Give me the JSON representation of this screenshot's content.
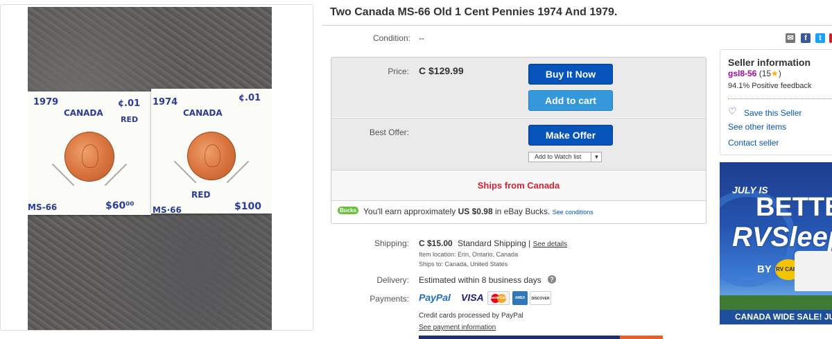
{
  "listing": {
    "title": "Two Canada MS-66 Old 1 Cent Pennies 1974 And 1979.",
    "condition_label": "Condition:",
    "condition_value": "--",
    "price_label": "Price:",
    "price_value": "C $129.99",
    "buy_now_label": "Buy It Now",
    "add_to_cart_label": "Add to cart",
    "best_offer_label": "Best Offer:",
    "make_offer_label": "Make Offer",
    "watch_label": "Add to Watch list",
    "ships_from": "Ships from Canada",
    "bucks_badge": "Bucks",
    "bucks_text": "You'll earn approximately",
    "bucks_amount": "US $0.98",
    "bucks_suffix": "in eBay Bucks.",
    "bucks_conditions": "See conditions"
  },
  "shipping": {
    "label": "Shipping:",
    "cost": "C $15.00",
    "method": "Standard Shipping",
    "details_link": "See details",
    "location": "Item location:  Erin, Ontario, Canada",
    "ships_to": "Ships to:  Canada, United States"
  },
  "delivery": {
    "label": "Delivery:",
    "value": "Estimated within 8 business days",
    "info_icon": "?"
  },
  "payments": {
    "label": "Payments:",
    "paypal": "PayPal",
    "visa": "VISA",
    "mastercard": "MasterCard",
    "amex": "AMEX",
    "discover": "DISCOVER",
    "credit_note": "Credit cards processed by PayPal",
    "info_link": "See payment information"
  },
  "seller": {
    "heading": "Seller information",
    "username": "gsl8-56",
    "feedback_count": "(15",
    "feedback_close": ")",
    "positive": "94.1% Positive feedback",
    "save_label": "Save this Seller",
    "other_items": "See other items",
    "contact": "Contact seller"
  },
  "photo": {
    "card1_year": "1979",
    "card1_country": "CANADA",
    "card1_denom": "¢.01",
    "card1_color": "RED",
    "card1_grade": "MS-66",
    "card1_price": "$60⁰⁰",
    "card2_year": "1974",
    "card2_country": "CANADA",
    "card2_denom": "¢.01",
    "card2_color": "RED",
    "card2_grade": "MS·66",
    "card2_price": "$100"
  },
  "ad": {
    "line1": "JULY IS",
    "line2": "BETTER",
    "line3": "RVSleep",
    "by": "BY",
    "brand": "RV CARE",
    "footer": "CANADA WIDE SALE! JU"
  },
  "icons": {
    "email": "email-icon",
    "facebook": "facebook-icon",
    "twitter": "twitter-icon",
    "pinterest": "pinterest-icon",
    "heart": "heart-icon",
    "star": "star-icon"
  },
  "colors": {
    "buy_button": "#0654ba",
    "cart_button": "#3498db",
    "ships_red": "#dd1e31",
    "link_blue": "#0654ba",
    "seller_purple": "#a00a9c",
    "bucks_green": "#6cbf3d"
  }
}
